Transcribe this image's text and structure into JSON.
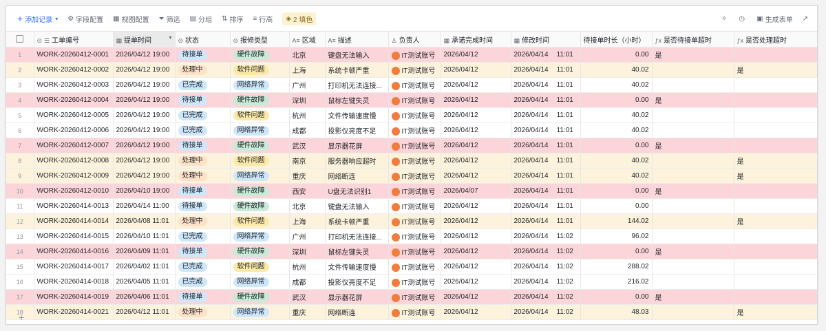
{
  "toolbar": {
    "add_record": "添加记录",
    "field_config": "字段配置",
    "view_config": "视图配置",
    "filter": "筛选",
    "group": "分组",
    "sort": "排序",
    "row_height": "行高",
    "fill_color": "2 填色",
    "generate_form": "生成表单"
  },
  "columns": {
    "id": "工单编号",
    "submit_time": "提单时间",
    "status": "状态",
    "issue_type": "报修类型",
    "region": "区域",
    "description": "描述",
    "owner": "负责人",
    "promised": "承诺完成时间",
    "modified": "修改时间",
    "wait_hours": "待接单时长（小时）",
    "wait_overdue": "是否待接单超时",
    "proc_overdue": "是否处理超时"
  },
  "rows": [
    {
      "idx": "1",
      "color": "pink",
      "id": "WORK-20260412-0001",
      "submit_date": "2026/04/12",
      "submit_time": "19:00",
      "status": "待接单",
      "type": "硬件故障",
      "region": "北京",
      "desc": "键盘无法输入",
      "owner": "IT测试账号",
      "promised": "2026/04/12",
      "mod_date": "2026/04/14",
      "mod_time": "11:01",
      "hours": "0.00",
      "wait_overdue": "是",
      "proc_overdue": ""
    },
    {
      "idx": "2",
      "color": "yellow",
      "id": "WORK-20260412-0002",
      "submit_date": "2026/04/12",
      "submit_time": "19:00",
      "status": "处理中",
      "type": "软件问题",
      "region": "上海",
      "desc": "系统卡顿严重",
      "owner": "IT测试账号",
      "promised": "2026/04/12",
      "mod_date": "2026/04/14",
      "mod_time": "11:01",
      "hours": "40.02",
      "wait_overdue": "",
      "proc_overdue": "是"
    },
    {
      "idx": "3",
      "color": "white",
      "id": "WORK-20260412-0003",
      "submit_date": "2026/04/12",
      "submit_time": "19:00",
      "status": "已完成",
      "type": "网络异常",
      "region": "广州",
      "desc": "打印机无法连接...",
      "owner": "IT测试账号",
      "promised": "2026/04/12",
      "mod_date": "2026/04/14",
      "mod_time": "11:01",
      "hours": "40.02",
      "wait_overdue": "",
      "proc_overdue": ""
    },
    {
      "idx": "4",
      "color": "pink",
      "id": "WORK-20260412-0004",
      "submit_date": "2026/04/12",
      "submit_time": "19:00",
      "status": "待接单",
      "type": "硬件故障",
      "region": "深圳",
      "desc": "鼠标左键失灵",
      "owner": "IT测试账号",
      "promised": "2026/04/12",
      "mod_date": "2026/04/14",
      "mod_time": "11:01",
      "hours": "0.00",
      "wait_overdue": "是",
      "proc_overdue": ""
    },
    {
      "idx": "5",
      "color": "white",
      "id": "WORK-20260412-0005",
      "submit_date": "2026/04/12",
      "submit_time": "19:00",
      "status": "已完成",
      "type": "软件问题",
      "region": "杭州",
      "desc": "文件传输速度慢",
      "owner": "IT测试账号",
      "promised": "2026/04/12",
      "mod_date": "2026/04/14",
      "mod_time": "11:01",
      "hours": "40.02",
      "wait_overdue": "",
      "proc_overdue": ""
    },
    {
      "idx": "6",
      "color": "white",
      "id": "WORK-20260412-0006",
      "submit_date": "2026/04/12",
      "submit_time": "19:00",
      "status": "已完成",
      "type": "网络异常",
      "region": "成都",
      "desc": "投影仪亮度不足",
      "owner": "IT测试账号",
      "promised": "2026/04/12",
      "mod_date": "2026/04/14",
      "mod_time": "11:01",
      "hours": "40.02",
      "wait_overdue": "",
      "proc_overdue": ""
    },
    {
      "idx": "7",
      "color": "pink",
      "id": "WORK-20260412-0007",
      "submit_date": "2026/04/12",
      "submit_time": "19:00",
      "status": "待接单",
      "type": "硬件故障",
      "region": "武汉",
      "desc": "显示器花屏",
      "owner": "IT测试账号",
      "promised": "2026/04/12",
      "mod_date": "2026/04/14",
      "mod_time": "11:01",
      "hours": "0.00",
      "wait_overdue": "是",
      "proc_overdue": ""
    },
    {
      "idx": "8",
      "color": "yellow",
      "id": "WORK-20260412-0008",
      "submit_date": "2026/04/12",
      "submit_time": "19:00",
      "status": "处理中",
      "type": "软件问题",
      "region": "南京",
      "desc": "服务器响应超时",
      "owner": "IT测试账号",
      "promised": "2026/04/12",
      "mod_date": "2026/04/14",
      "mod_time": "11:01",
      "hours": "40.02",
      "wait_overdue": "",
      "proc_overdue": "是"
    },
    {
      "idx": "9",
      "color": "yellow",
      "id": "WORK-20260412-0009",
      "submit_date": "2026/04/12",
      "submit_time": "19:00",
      "status": "处理中",
      "type": "网络异常",
      "region": "重庆",
      "desc": "网络断连",
      "owner": "IT测试账号",
      "promised": "2026/04/12",
      "mod_date": "2026/04/14",
      "mod_time": "11:01",
      "hours": "40.02",
      "wait_overdue": "",
      "proc_overdue": "是"
    },
    {
      "idx": "10",
      "color": "pink",
      "id": "WORK-20260412-0010",
      "submit_date": "2026/04/10",
      "submit_time": "19:00",
      "status": "待接单",
      "type": "硬件故障",
      "region": "西安",
      "desc": "U盘无法识别1",
      "owner": "IT测试账号",
      "promised": "2026/04/07",
      "mod_date": "2026/04/14",
      "mod_time": "11:01",
      "hours": "0.00",
      "wait_overdue": "是",
      "proc_overdue": ""
    },
    {
      "idx": "11",
      "color": "white",
      "id": "WORK-20260414-0013",
      "submit_date": "2026/04/14",
      "submit_time": "11:00",
      "status": "待接单",
      "type": "硬件故障",
      "region": "北京",
      "desc": "键盘无法输入",
      "owner": "IT测试账号",
      "promised": "2026/04/12",
      "mod_date": "2026/04/14",
      "mod_time": "11:01",
      "hours": "0.00",
      "wait_overdue": "",
      "proc_overdue": ""
    },
    {
      "idx": "12",
      "color": "yellow",
      "id": "WORK-20260414-0014",
      "submit_date": "2026/04/08",
      "submit_time": "11:01",
      "status": "处理中",
      "type": "软件问题",
      "region": "上海",
      "desc": "系统卡顿严重",
      "owner": "IT测试账号",
      "promised": "2026/04/12",
      "mod_date": "2026/04/14",
      "mod_time": "11:01",
      "hours": "144.02",
      "wait_overdue": "",
      "proc_overdue": "是"
    },
    {
      "idx": "13",
      "color": "white",
      "id": "WORK-20260414-0015",
      "submit_date": "2026/04/10",
      "submit_time": "11:01",
      "status": "已完成",
      "type": "网络异常",
      "region": "广州",
      "desc": "打印机无法连接...",
      "owner": "IT测试账号",
      "promised": "2026/04/12",
      "mod_date": "2026/04/14",
      "mod_time": "11:02",
      "hours": "96.02",
      "wait_overdue": "",
      "proc_overdue": ""
    },
    {
      "idx": "14",
      "color": "pink",
      "id": "WORK-20260414-0016",
      "submit_date": "2026/04/09",
      "submit_time": "11:01",
      "status": "待接单",
      "type": "硬件故障",
      "region": "深圳",
      "desc": "鼠标左键失灵",
      "owner": "IT测试账号",
      "promised": "2026/04/12",
      "mod_date": "2026/04/14",
      "mod_time": "11:02",
      "hours": "0.00",
      "wait_overdue": "是",
      "proc_overdue": ""
    },
    {
      "idx": "15",
      "color": "white",
      "id": "WORK-20260414-0017",
      "submit_date": "2026/04/02",
      "submit_time": "11:01",
      "status": "已完成",
      "type": "软件问题",
      "region": "杭州",
      "desc": "文件传输速度慢",
      "owner": "IT测试账号",
      "promised": "2026/04/12",
      "mod_date": "2026/04/14",
      "mod_time": "11:02",
      "hours": "288.02",
      "wait_overdue": "",
      "proc_overdue": ""
    },
    {
      "idx": "16",
      "color": "white",
      "id": "WORK-20260414-0018",
      "submit_date": "2026/04/05",
      "submit_time": "11:01",
      "status": "已完成",
      "type": "网络异常",
      "region": "成都",
      "desc": "投影仪亮度不足",
      "owner": "IT测试账号",
      "promised": "2026/04/12",
      "mod_date": "2026/04/14",
      "mod_time": "11:02",
      "hours": "216.02",
      "wait_overdue": "",
      "proc_overdue": ""
    },
    {
      "idx": "17",
      "color": "pink",
      "id": "WORK-20260414-0019",
      "submit_date": "2026/04/06",
      "submit_time": "11:01",
      "status": "待接单",
      "type": "硬件故障",
      "region": "武汉",
      "desc": "显示器花屏",
      "owner": "IT测试账号",
      "promised": "2026/04/12",
      "mod_date": "2026/04/14",
      "mod_time": "11:02",
      "hours": "0.00",
      "wait_overdue": "是",
      "proc_overdue": ""
    },
    {
      "idx": "18",
      "color": "yellow",
      "id": "WORK-20260414-0021",
      "submit_date": "2026/04/12",
      "submit_time": "11:01",
      "status": "处理中",
      "type": "网络异常",
      "region": "重庆",
      "desc": "网络断连",
      "owner": "IT测试账号",
      "promised": "2026/04/12",
      "mod_date": "2026/04/14",
      "mod_time": "11:02",
      "hours": "48.03",
      "wait_overdue": "",
      "proc_overdue": "是"
    }
  ],
  "colors": {
    "pink": "#fbd5d9",
    "yellow": "#fdf3dc",
    "accent": "#3370ff",
    "avatar": "#f07c3e"
  },
  "icons": [
    "plus-icon",
    "gear-icon",
    "view-icon",
    "filter-icon",
    "group-icon",
    "sort-icon",
    "row-height-icon",
    "fill-color-icon",
    "magic-icon",
    "history-icon",
    "form-icon",
    "share-icon",
    "lock-icon",
    "list-icon",
    "calendar-icon",
    "status-icon",
    "text-icon",
    "person-icon",
    "formula-icon"
  ]
}
